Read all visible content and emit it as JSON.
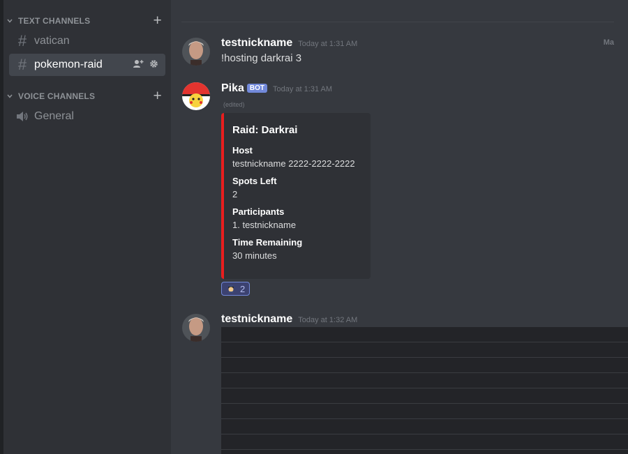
{
  "sidebar": {
    "text_category": "TEXT CHANNELS",
    "voice_category": "VOICE CHANNELS",
    "text_channels": [
      {
        "name": "vatican",
        "active": false
      },
      {
        "name": "pokemon-raid",
        "active": true
      }
    ],
    "voice_channels": [
      {
        "name": "General"
      }
    ],
    "add_icon": "plus-icon",
    "invite_icon": "add-member-icon",
    "settings_icon": "gear-icon"
  },
  "chat": {
    "divider_label": "Ma",
    "messages": [
      {
        "author": "testnickname",
        "time": "Today at 1:31 AM",
        "text": "!hosting darkrai 3"
      },
      {
        "author": "Pika",
        "badge": "BOT",
        "time": "Today at 1:31 AM",
        "edited": "(edited)",
        "embed": {
          "color": "#e91e1e",
          "title": "Raid: Darkrai",
          "fields": [
            {
              "name": "Host",
              "value": "testnickname 2222-2222-2222"
            },
            {
              "name": "Spots Left",
              "value": "2"
            },
            {
              "name": "Participants",
              "value": "1. testnickname"
            },
            {
              "name": "Time Remaining",
              "value": "30 minutes"
            }
          ]
        },
        "reaction": {
          "icon": "cop-emoji-icon",
          "count": "2"
        }
      },
      {
        "author": "testnickname",
        "time": "Today at 1:32 AM"
      }
    ]
  },
  "colors": {
    "background": "#36393f",
    "sidebar": "#2f3136",
    "accent": "#7289da",
    "embed_bar": "#e91e1e"
  }
}
